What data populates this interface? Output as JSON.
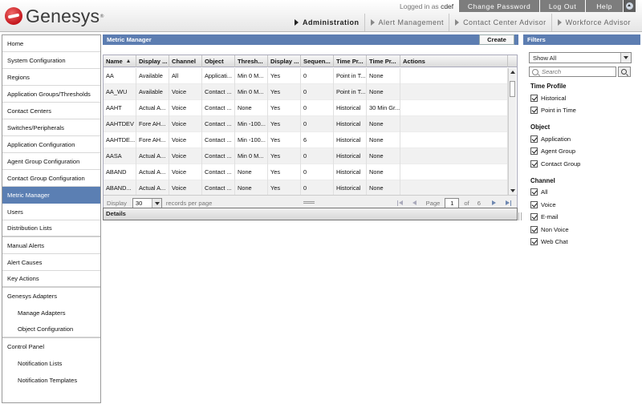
{
  "header": {
    "logo_text": "Genesys",
    "logged_in_prefix": "Logged in as",
    "username": "cdef",
    "links": {
      "change_password": "Change Password",
      "log_out": "Log Out",
      "help": "Help"
    },
    "tabs": [
      "Administration",
      "Alert Management",
      "Contact Center Advisor",
      "Workforce Advisor"
    ],
    "active_tab": "Administration"
  },
  "sidebar": {
    "items": [
      {
        "label": "Home"
      },
      {
        "label": "System Configuration"
      },
      {
        "label": "Regions"
      },
      {
        "label": "Application Groups/Thresholds"
      },
      {
        "label": "Contact Centers"
      },
      {
        "label": "Switches/Peripherals"
      },
      {
        "label": "Application Configuration"
      },
      {
        "label": "Agent Group Configuration"
      },
      {
        "label": "Contact Group Configuration"
      },
      {
        "label": "Metric Manager"
      },
      {
        "label": "Users"
      },
      {
        "label": "Distribution Lists"
      },
      {
        "label": "Manual Alerts"
      },
      {
        "label": "Alert Causes"
      },
      {
        "label": "Key Actions"
      },
      {
        "label": "Genesys Adapters"
      },
      {
        "label": "Manage Adapters"
      },
      {
        "label": "Object Configuration"
      },
      {
        "label": "Control Panel"
      },
      {
        "label": "Notification Lists"
      },
      {
        "label": "Notification Templates"
      }
    ],
    "active": "Metric Manager"
  },
  "main": {
    "title": "Metric Manager",
    "create_label": "Create",
    "columns": [
      "Name",
      "Display ...",
      "Channel",
      "Object",
      "Thresh...",
      "Display ...",
      "Sequen...",
      "Time Pr...",
      "Time Pr...",
      "Actions"
    ],
    "rows": [
      [
        "AA",
        "Available",
        "All",
        "Applicati...",
        "Min 0  M...",
        "Yes",
        "0",
        "Point in T...",
        "None",
        ""
      ],
      [
        "AA_WU",
        "Available",
        "Voice",
        "Contact ...",
        "Min 0  M...",
        "Yes",
        "0",
        "Point in T...",
        "None",
        ""
      ],
      [
        "AAHT",
        "Actual A...",
        "Voice",
        "Contact ...",
        "None",
        "Yes",
        "0",
        "Historical",
        "30 Min Gr...",
        ""
      ],
      [
        "AAHTDEV",
        "Fore AH...",
        "Voice",
        "Contact ...",
        "Min -100...",
        "Yes",
        "0",
        "Historical",
        "None",
        ""
      ],
      [
        "AAHTDE...",
        "Fore AH...",
        "Voice",
        "Contact ...",
        "Min -100...",
        "Yes",
        "6",
        "Historical",
        "None",
        ""
      ],
      [
        "AASA",
        "Actual A...",
        "Voice",
        "Contact ...",
        "Min 0  M...",
        "Yes",
        "0",
        "Historical",
        "None",
        ""
      ],
      [
        "ABAND",
        "Actual A...",
        "Voice",
        "Contact ...",
        "None",
        "Yes",
        "0",
        "Historical",
        "None",
        ""
      ],
      [
        "ABAND...",
        "Actual A...",
        "Voice",
        "Contact ...",
        "None",
        "Yes",
        "0",
        "Historical",
        "None",
        ""
      ]
    ],
    "pager": {
      "display_label": "Display",
      "page_size": "30",
      "records_label": "records per page",
      "page_label": "Page",
      "current_page": "1",
      "of_label": "of",
      "total_pages": "6"
    },
    "details_label": "Details"
  },
  "filters": {
    "title": "Filters",
    "show_value": "Show All",
    "search_placeholder": "Search",
    "groups": [
      {
        "title": "Time Profile",
        "items": [
          "Historical",
          "Point in Time"
        ]
      },
      {
        "title": "Object",
        "items": [
          "Application",
          "Agent Group",
          "Contact Group"
        ]
      },
      {
        "title": "Channel",
        "items": [
          "All",
          "Voice",
          "E-mail",
          "Non Voice",
          "Web Chat"
        ]
      }
    ]
  },
  "colors": {
    "accent": "#5c7db1",
    "nav_active": "#5b7fb3",
    "topbar": "#7d7d7d"
  }
}
